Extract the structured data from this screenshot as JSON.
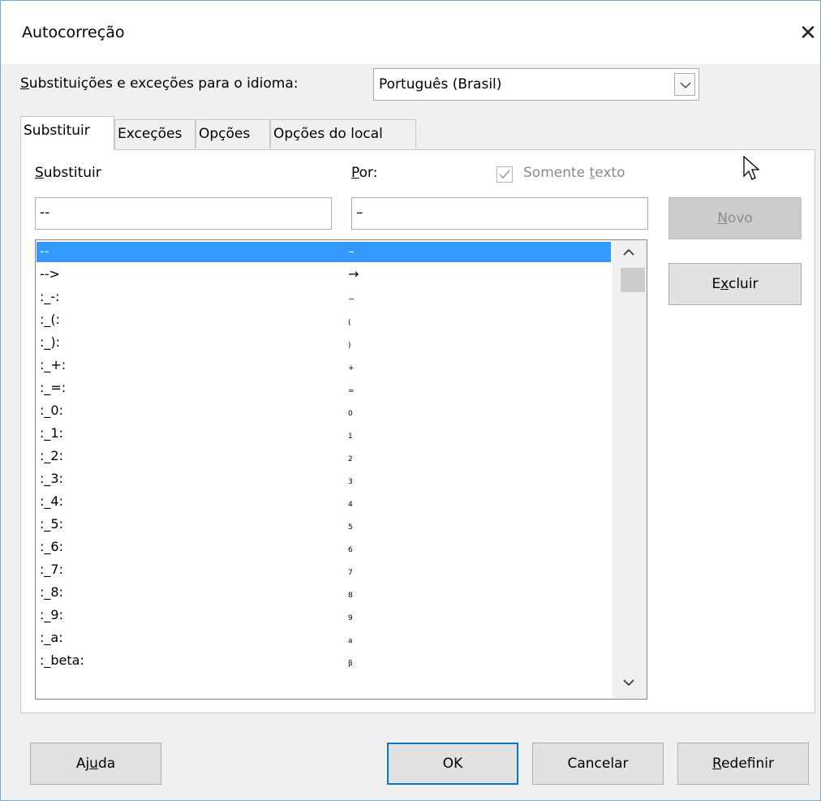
{
  "window": {
    "title": "Autocorreção"
  },
  "language": {
    "label_pre": "S",
    "label_rest": "ubstituições e exceções para o idioma:",
    "value": "Português (Brasil)"
  },
  "tabs": [
    {
      "label": "Substituir"
    },
    {
      "label": "Exceções"
    },
    {
      "label": "Opções"
    },
    {
      "label": "Opções do local"
    }
  ],
  "replace": {
    "replace_label_pre": "S",
    "replace_label_rest": "ubstituir",
    "with_label_pre": "P",
    "with_label_rest": "or:",
    "text_only_pre": "Somente ",
    "text_only_u": "t",
    "text_only_rest": "exto",
    "text_only_checked": true,
    "replace_value": "--",
    "with_value": "–"
  },
  "entries": [
    {
      "key": "--",
      "value": "–",
      "small": false
    },
    {
      "key": "-->",
      "value": "→",
      "small": false
    },
    {
      "key": ":_-:",
      "value": "₋",
      "small": false
    },
    {
      "key": ":_(:",
      "value": "(",
      "small": true
    },
    {
      "key": ":_):",
      "value": ")",
      "small": true
    },
    {
      "key": ":_+:",
      "value": "+",
      "small": true
    },
    {
      "key": ":_=:",
      "value": "=",
      "small": true
    },
    {
      "key": ":_0:",
      "value": "0",
      "small": true
    },
    {
      "key": ":_1:",
      "value": "1",
      "small": true
    },
    {
      "key": ":_2:",
      "value": "2",
      "small": true
    },
    {
      "key": ":_3:",
      "value": "3",
      "small": true
    },
    {
      "key": ":_4:",
      "value": "4",
      "small": true
    },
    {
      "key": ":_5:",
      "value": "5",
      "small": true
    },
    {
      "key": ":_6:",
      "value": "6",
      "small": true
    },
    {
      "key": ":_7:",
      "value": "7",
      "small": true
    },
    {
      "key": ":_8:",
      "value": "8",
      "small": true
    },
    {
      "key": ":_9:",
      "value": "9",
      "small": true
    },
    {
      "key": ":_a:",
      "value": "a",
      "small": true
    },
    {
      "key": ":_beta:",
      "value": "β",
      "small": true
    }
  ],
  "side_buttons": {
    "new_pre": "",
    "new_u": "N",
    "new_rest": "ovo",
    "delete_pre": "E",
    "delete_u": "x",
    "delete_rest": "cluir"
  },
  "footer": {
    "help_pre": "Aj",
    "help_u": "u",
    "help_rest": "da",
    "ok": "OK",
    "cancel": "Cancelar",
    "reset_u": "R",
    "reset_rest": "edefinir"
  }
}
